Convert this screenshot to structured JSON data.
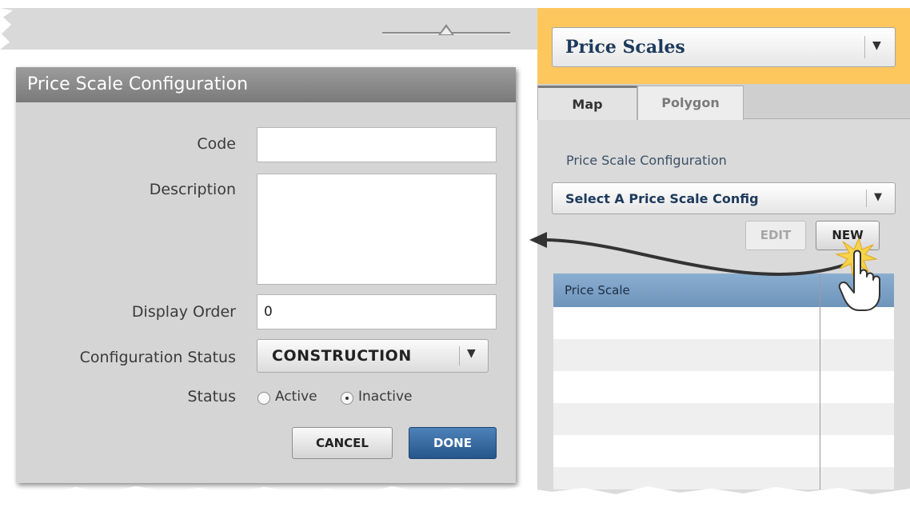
{
  "dialog": {
    "title": "Price Scale Configuration",
    "code_label": "Code",
    "code_value": "",
    "description_label": "Description",
    "description_value": "",
    "display_order_label": "Display Order",
    "display_order_value": "0",
    "config_status_label": "Configuration Status",
    "config_status_value": "CONSTRUCTION",
    "status_label": "Status",
    "status_options": [
      "Active",
      "Inactive"
    ],
    "status_selected": "Inactive",
    "cancel_label": "CANCEL",
    "done_label": "DONE"
  },
  "right": {
    "dropdown_label": "Price Scales",
    "tabs": [
      "Map",
      "Polygon"
    ],
    "active_tab": "Map",
    "config_label": "Price Scale Configuration",
    "config_select": "Select A Price Scale Config",
    "edit_label": "EDIT",
    "new_label": "NEW",
    "grid_header": "Price Scale"
  },
  "colors": {
    "accent_orange": "#fdc75e",
    "header_blue": "#7a9ec4",
    "done_blue": "#2f6299",
    "dialog_gray": "#d5d5d5"
  },
  "icons": [
    "slider-icon",
    "chevron-down-icon",
    "pointer-hand-icon",
    "curved-arrow-icon",
    "radio-icon"
  ]
}
